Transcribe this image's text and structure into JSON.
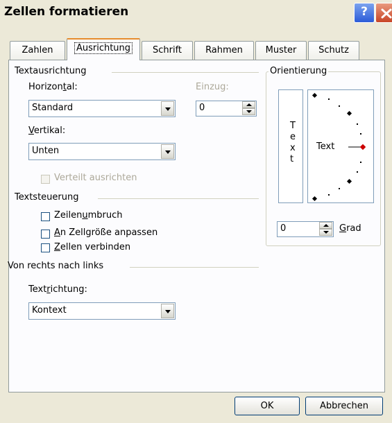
{
  "window": {
    "title": "Zellen formatieren",
    "help_icon_label": "?"
  },
  "tabs": [
    {
      "label": "Zahlen"
    },
    {
      "label": "Ausrichtung"
    },
    {
      "label": "Schrift"
    },
    {
      "label": "Rahmen"
    },
    {
      "label": "Muster"
    },
    {
      "label": "Schutz"
    }
  ],
  "textausrichtung": {
    "heading": "Textausrichtung",
    "horizontal": {
      "label_pre": "Horizon",
      "label_ul": "t",
      "label_post": "al:",
      "value": "Standard"
    },
    "einzug": {
      "label": "Einzug:",
      "value": "0"
    },
    "vertikal": {
      "label_ul": "V",
      "label_post": "ertikal:",
      "value": "Unten"
    },
    "verteilt": {
      "label": "Verteilt ausrichten",
      "checked": false,
      "enabled": false
    }
  },
  "textsteuerung": {
    "heading": "Textsteuerung",
    "zeilenumbruch": {
      "label_pre": "Zeilen",
      "label_ul": "u",
      "label_post": "mbruch",
      "checked": false
    },
    "anpassen": {
      "label_ul": "A",
      "label_post": "n Zellgröße anpassen",
      "checked": false
    },
    "verbinden": {
      "label_ul": "Z",
      "label_post": "ellen verbinden",
      "checked": false
    }
  },
  "rtl": {
    "heading": "Von rechts nach links",
    "textrichtung": {
      "label_pre": "Text",
      "label_ul": "r",
      "label_post": "ichtung:",
      "value": "Kontext"
    }
  },
  "orientierung": {
    "heading": "Orientierung",
    "vertical_letters": [
      "T",
      "e",
      "x",
      "t"
    ],
    "dial_text": "Text",
    "degrees": "0",
    "grad_label_ul": "G",
    "grad_label_post": "rad",
    "pointer_color": "#CC0000"
  },
  "buttons": {
    "ok": "OK",
    "cancel": "Abbrechen"
  }
}
